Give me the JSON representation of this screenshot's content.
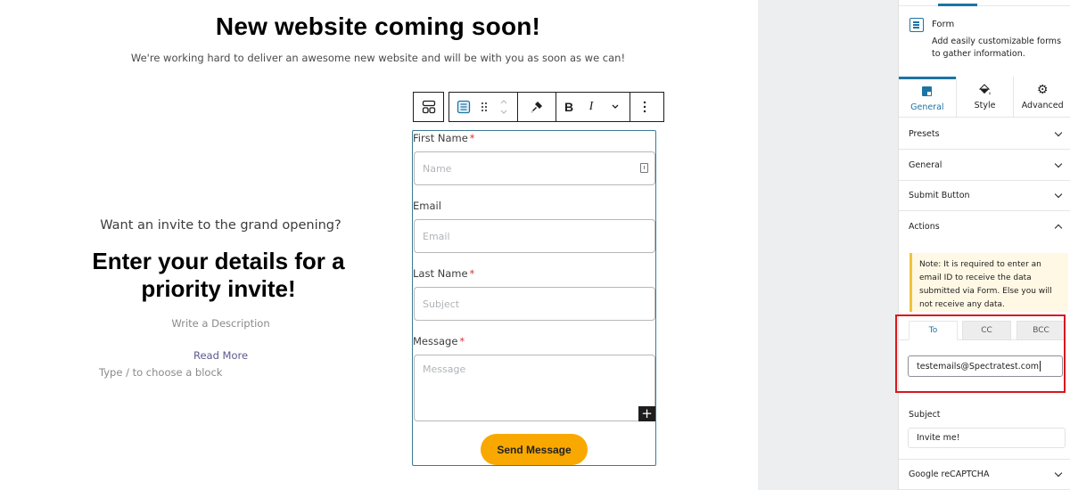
{
  "canvas": {
    "hero_title": "New website coming soon!",
    "hero_subtitle": "We're working hard to deliver an awesome new website and will be with you as soon as we can!",
    "invite_question": "Want an invite to the grand opening?",
    "invite_title": "Enter your details for a priority invite!",
    "description_placeholder": "Write a Description",
    "read_more": "Read More",
    "block_hint": "Type / to choose a block"
  },
  "toolbar": {
    "buttons": [
      {
        "name": "block-switcher",
        "icon": "layout-grid-icon"
      },
      {
        "name": "form-block",
        "icon": "form-icon"
      },
      {
        "name": "drag-handle",
        "icon": "drag-dots-icon"
      },
      {
        "name": "move-up-down",
        "icon": "chevron-updown-icon"
      },
      {
        "name": "style-brush",
        "icon": "paintbrush-icon"
      },
      {
        "name": "bold",
        "label": "B"
      },
      {
        "name": "italic",
        "label": "I"
      },
      {
        "name": "more-formatting",
        "icon": "chevron-down-icon"
      },
      {
        "name": "options",
        "icon": "vertical-ellipsis-icon"
      }
    ],
    "bold_label": "B",
    "italic_label": "I"
  },
  "form": {
    "fields": [
      {
        "label": "First Name",
        "required": true,
        "placeholder": "Name"
      },
      {
        "label": "Email",
        "required": false,
        "placeholder": "Email"
      },
      {
        "label": "Last Name",
        "required": true,
        "placeholder": "Subject"
      },
      {
        "label": "Message",
        "required": true,
        "placeholder": "Message"
      }
    ],
    "required_mark": "*",
    "submit_label": "Send Message",
    "submit_color": "#f9a800",
    "plus_label": "+"
  },
  "sidebar": {
    "block_name": "Form",
    "block_description": "Add easily customizable forms to gather information.",
    "tabs": [
      {
        "label": "General",
        "icon": "general-icon",
        "active": true
      },
      {
        "label": "Style",
        "icon": "paint-bucket-icon",
        "active": false
      },
      {
        "label": "Advanced",
        "icon": "gear-icon",
        "active": false
      }
    ],
    "panels": [
      {
        "label": "Presets",
        "expanded": false
      },
      {
        "label": "General",
        "expanded": false
      },
      {
        "label": "Submit Button",
        "expanded": false
      },
      {
        "label": "Actions",
        "expanded": true
      }
    ],
    "note": "Note: It is required to enter an email ID to receive the data submitted via Form. Else you will not receive any data.",
    "email_tabs": [
      {
        "label": "To",
        "active": true
      },
      {
        "label": "CC",
        "active": false
      },
      {
        "label": "BCC",
        "active": false
      }
    ],
    "email_value": "testemails@Spectratest.com",
    "subject_label": "Subject",
    "subject_value": "Invite me!",
    "recaptcha_label": "Google reCAPTCHA",
    "accent_color": "#1c74a3",
    "highlight_color": "#d8181e"
  }
}
